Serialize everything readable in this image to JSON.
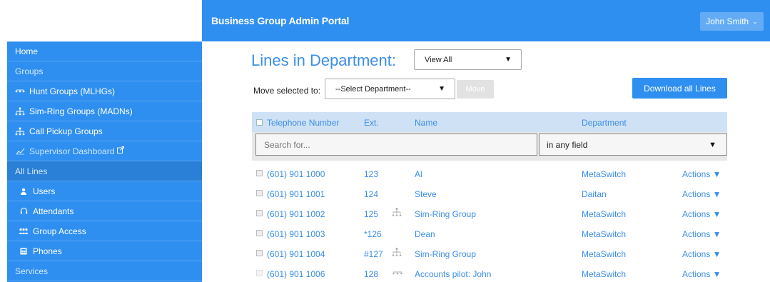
{
  "header": {
    "title": "Business Group Admin Portal",
    "user": "John Smith",
    "user_caret": "⌄"
  },
  "sidebar": {
    "home": "Home",
    "groups_header": "Groups",
    "groups": [
      {
        "label": "Hunt Groups (MLHGs)",
        "icon": "hunt-group-icon"
      },
      {
        "label": "Sim-Ring Groups (MADNs)",
        "icon": "sim-ring-icon"
      },
      {
        "label": "Call Pickup Groups",
        "icon": "call-pickup-icon"
      },
      {
        "label": "Supervisor Dashboard",
        "icon": "dashboard-icon"
      }
    ],
    "all_lines_header": "All Lines",
    "lines": [
      {
        "label": "Users",
        "icon": "user-icon"
      },
      {
        "label": "Attendants",
        "icon": "headset-icon"
      },
      {
        "label": "Group Access",
        "icon": "group-icon"
      },
      {
        "label": "Phones",
        "icon": "phone-icon"
      }
    ],
    "services_header": "Services"
  },
  "main": {
    "title": "Lines in Department:",
    "view_select": "View All",
    "move_label": "Move selected to:",
    "dept_select": "--Select Department--",
    "move_button": "Move",
    "download_button": "Download all Lines"
  },
  "table": {
    "headers": {
      "tel": "Telephone Number",
      "ext": "Ext.",
      "name": "Name",
      "dept": "Department"
    },
    "search_placeholder": "Search for...",
    "field_select": "in any field",
    "rows": [
      {
        "tel": "(601) 901 1000",
        "ext": "123",
        "group_icon": "",
        "name": "Al",
        "dept": "MetaSwitch",
        "actions": "Actions ▼"
      },
      {
        "tel": "(601) 901 1001",
        "ext": "124",
        "group_icon": "",
        "name": "Steve",
        "dept": "Daitan",
        "actions": "Actions ▼"
      },
      {
        "tel": "(601) 901 1002",
        "ext": "125",
        "group_icon": "sim-ring-icon",
        "name": "Sim-Ring Group",
        "dept": "MetaSwitch",
        "actions": "Actions ▼"
      },
      {
        "tel": "(601) 901 1003",
        "ext": "*126",
        "group_icon": "",
        "name": "Dean",
        "dept": "MetaSwitch",
        "actions": "Actions ▼"
      },
      {
        "tel": "(601) 901 1004",
        "ext": "#127",
        "group_icon": "sim-ring-icon",
        "name": "Sim-Ring Group",
        "dept": "MetaSwitch",
        "actions": "Actions ▼"
      },
      {
        "tel": "(601) 901 1006",
        "ext": "128",
        "group_icon": "hunt-group-icon",
        "name": "Accounts pilot: John",
        "dept": "MetaSwitch",
        "actions": "Actions ▼"
      }
    ]
  },
  "colors": {
    "primary": "#2f8ff0",
    "link": "#3b8ee6",
    "table_header": "#cfe1f5"
  }
}
